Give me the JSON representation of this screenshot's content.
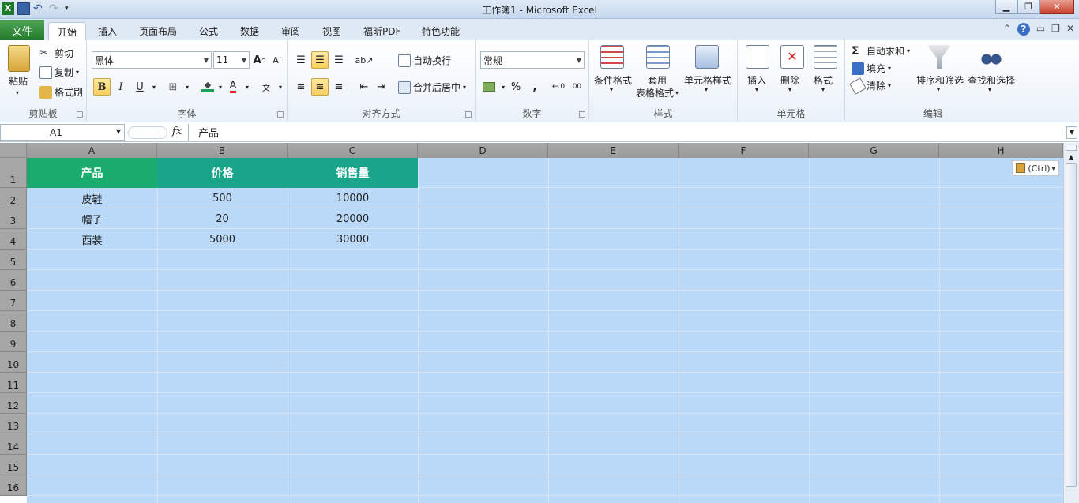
{
  "app": {
    "title": "工作簿1 - Microsoft Excel",
    "icons": [
      "excel-logo-icon",
      "save-icon",
      "undo-icon",
      "redo-icon",
      "customize-qat-icon"
    ]
  },
  "tabs": {
    "file": "文件",
    "items": [
      "开始",
      "插入",
      "页面布局",
      "公式",
      "数据",
      "审阅",
      "视图",
      "福昕PDF",
      "特色功能"
    ]
  },
  "ribbon": {
    "clipboard": {
      "paste": "粘贴",
      "cut": "剪切",
      "copy": "复制",
      "format_painter": "格式刷",
      "label": "剪贴板"
    },
    "font": {
      "name": "黑体",
      "size": "11",
      "label": "字体"
    },
    "alignment": {
      "wrap": "自动换行",
      "merge": "合并后居中",
      "label": "对齐方式"
    },
    "number": {
      "format": "常规",
      "percent": "%",
      "comma": ",",
      "label": "数字"
    },
    "styles": {
      "conditional": "条件格式",
      "table_1": "套用",
      "table_2": "表格格式",
      "cell_styles": "单元格样式",
      "label": "样式"
    },
    "cells": {
      "insert": "插入",
      "delete": "删除",
      "format": "格式",
      "label": "单元格"
    },
    "editing": {
      "autosum": "自动求和",
      "fill": "填充",
      "clear": "清除",
      "sort": "排序和筛选",
      "find": "查找和选择",
      "label": "编辑"
    }
  },
  "formula_bar": {
    "name_box": "A1",
    "fx": "fx",
    "content": "产品"
  },
  "sheet": {
    "columns": [
      "A",
      "B",
      "C",
      "D",
      "E",
      "F",
      "G",
      "H"
    ],
    "rows": [
      "1",
      "2",
      "3",
      "4",
      "5",
      "6",
      "7",
      "8",
      "9",
      "10",
      "11",
      "12",
      "13",
      "14",
      "15",
      "16"
    ],
    "header": [
      "产品",
      "价格",
      "销售量"
    ],
    "data": [
      [
        "皮鞋",
        "500",
        "10000"
      ],
      [
        "帽子",
        "20",
        "20000"
      ],
      [
        "西装",
        "5000",
        "30000"
      ]
    ],
    "paste_options": "(Ctrl)"
  },
  "colors": {
    "header_a": "#1aab6e",
    "header_bc": "#1aa58a",
    "selection": "#bad9f8"
  }
}
